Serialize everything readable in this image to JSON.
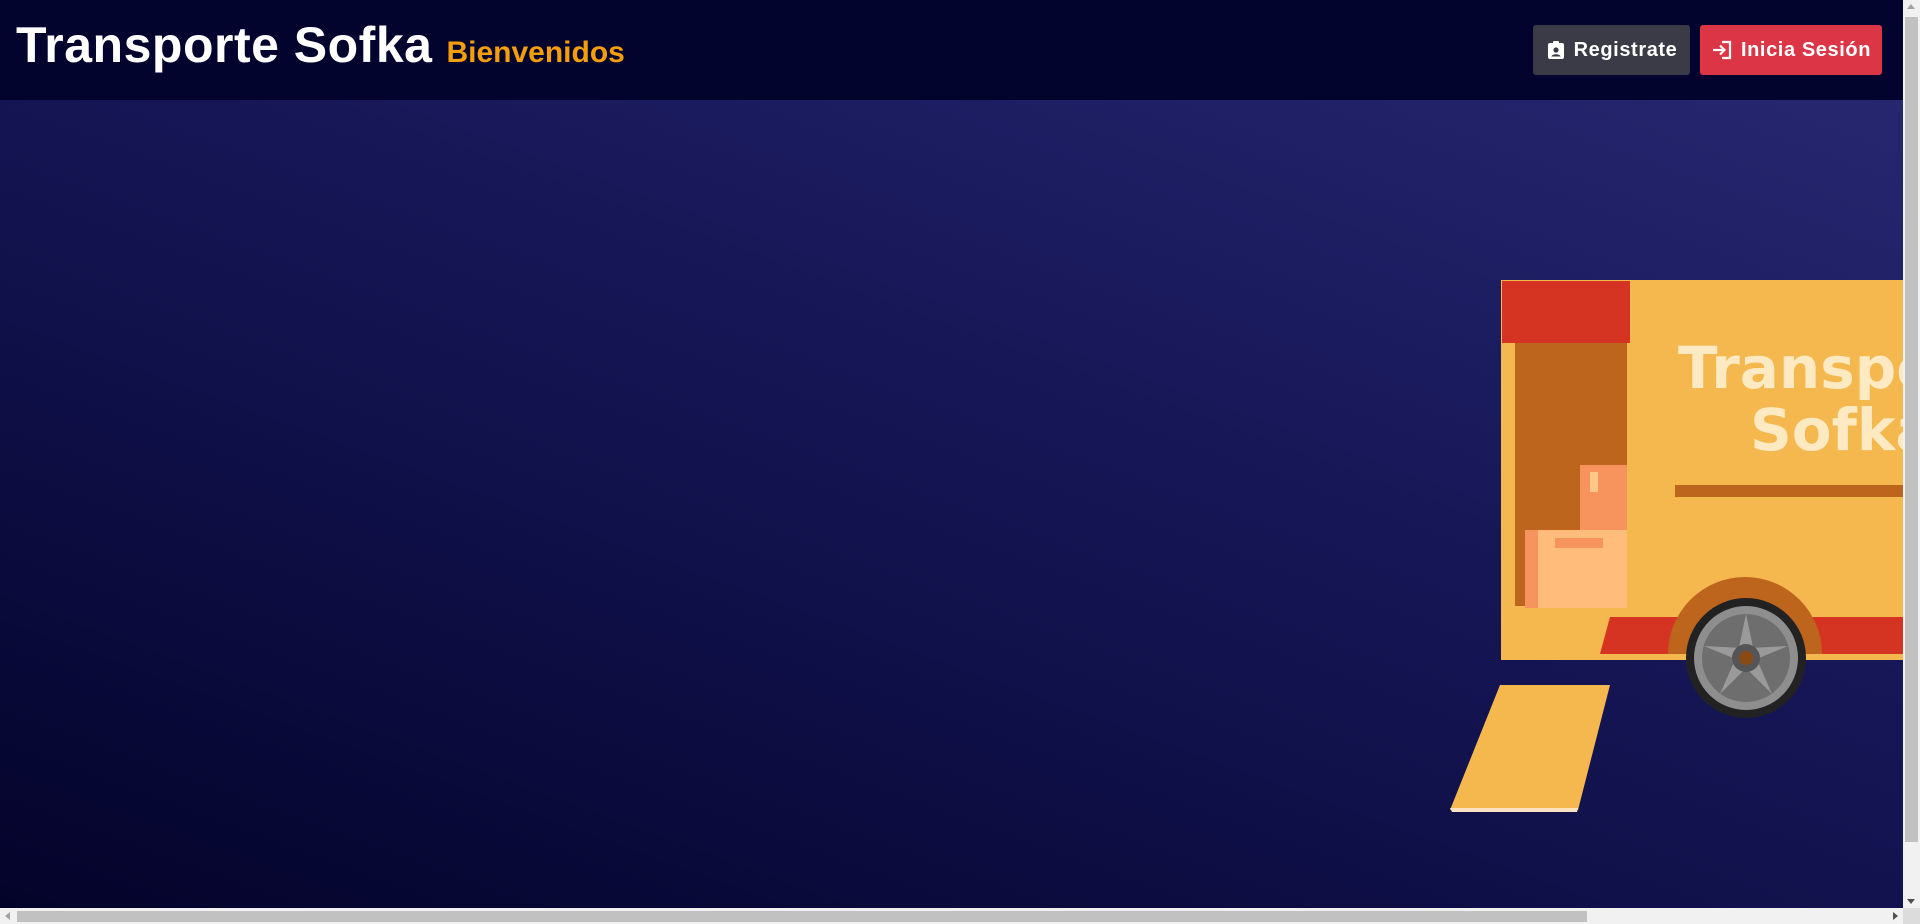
{
  "header": {
    "title": "Transporte Sofka",
    "subtitle": "Bienvenidos",
    "register_label": "Registrate",
    "login_label": "Inicia Sesión"
  },
  "hero": {
    "truck_text_line1": "Transpo",
    "truck_text_line2": "Sofka"
  },
  "colors": {
    "header_bg": "#03042e",
    "subtitle": "#f59e0b",
    "register_btn": "#3a3b46",
    "login_btn": "#dc3545",
    "truck_body": "#f4b84e",
    "truck_red": "#d63422"
  }
}
